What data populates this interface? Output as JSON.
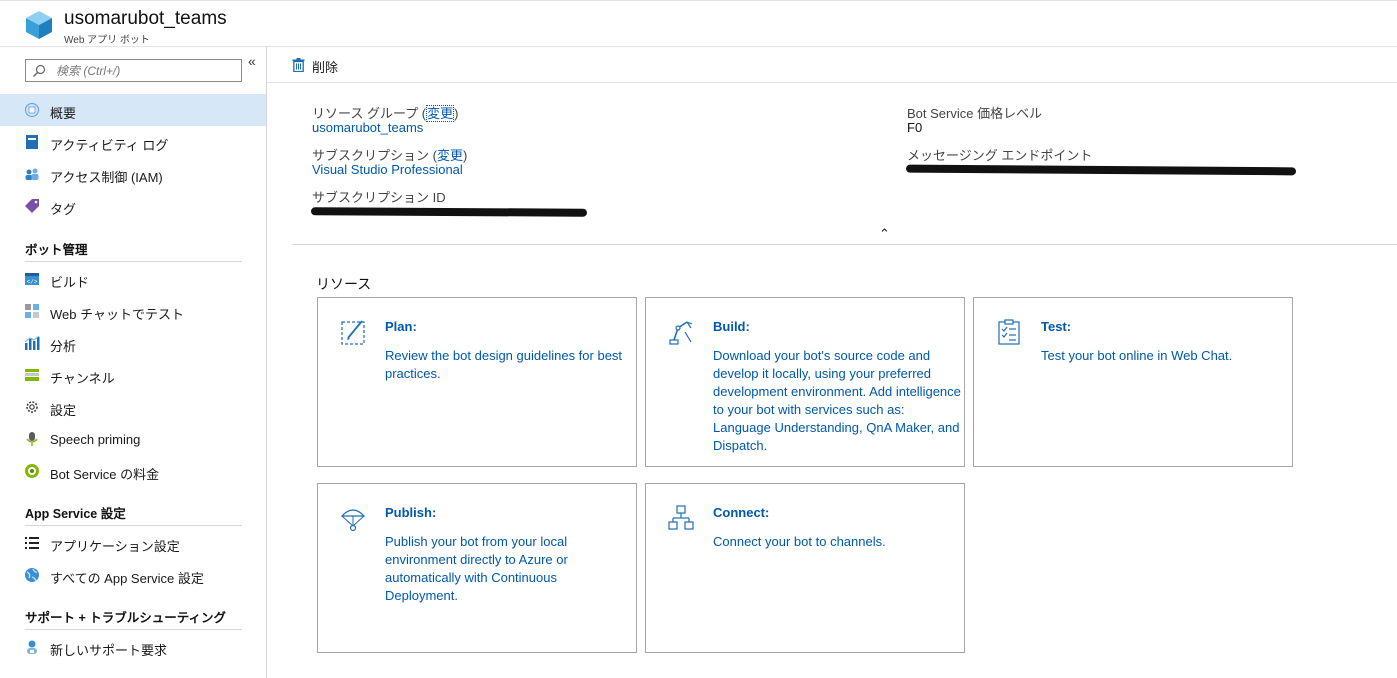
{
  "header": {
    "title": "usomarubot_teams",
    "subtitle": "Web アプリ ボット"
  },
  "search": {
    "placeholder": "検索 (Ctrl+/)"
  },
  "sidebar": {
    "items": [
      {
        "label": "概要"
      },
      {
        "label": "アクティビティ ログ"
      },
      {
        "label": "アクセス制御 (IAM)"
      },
      {
        "label": "タグ"
      }
    ],
    "sections": [
      {
        "title": "ボット管理",
        "items": [
          {
            "label": "ビルド"
          },
          {
            "label": "Web チャットでテスト"
          },
          {
            "label": "分析"
          },
          {
            "label": "チャンネル"
          },
          {
            "label": "設定"
          },
          {
            "label": "Speech priming"
          },
          {
            "label": "Bot Service の料金"
          }
        ]
      },
      {
        "title": "App Service 設定",
        "items": [
          {
            "label": "アプリケーション設定"
          },
          {
            "label": "すべての App Service 設定"
          }
        ]
      },
      {
        "title": "サポート + トラブルシューティング",
        "items": [
          {
            "label": "新しいサポート要求"
          }
        ]
      }
    ]
  },
  "toolbar": {
    "delete_label": "削除"
  },
  "essentials": {
    "resource_group_label": "リソース グループ (",
    "change_label": "変更",
    "close_paren": ")",
    "resource_group_value": "usomarubot_teams",
    "subscription_label": "サブスクリプション (",
    "subscription_value": "Visual Studio Professional",
    "subscription_id_label": "サブスクリプション ID",
    "pricing_label": "Bot Service 価格レベル",
    "pricing_value": "F0",
    "endpoint_label": "メッセージング エンドポイント"
  },
  "resources": {
    "label": "リソース",
    "cards": [
      {
        "title": "Plan:",
        "desc": "Review the bot design guidelines for best practices."
      },
      {
        "title": "Build:",
        "desc": "Download your bot's source code and develop it locally, using your preferred development environment. Add intelligence to your bot with services such as: Language Understanding, QnA Maker, and Dispatch."
      },
      {
        "title": "Test:",
        "desc": "Test your bot online in Web Chat."
      },
      {
        "title": "Publish:",
        "desc": "Publish your bot from your local environment directly to Azure or automatically with Continuous Deployment."
      },
      {
        "title": "Connect:",
        "desc": "Connect your bot to channels."
      }
    ]
  }
}
